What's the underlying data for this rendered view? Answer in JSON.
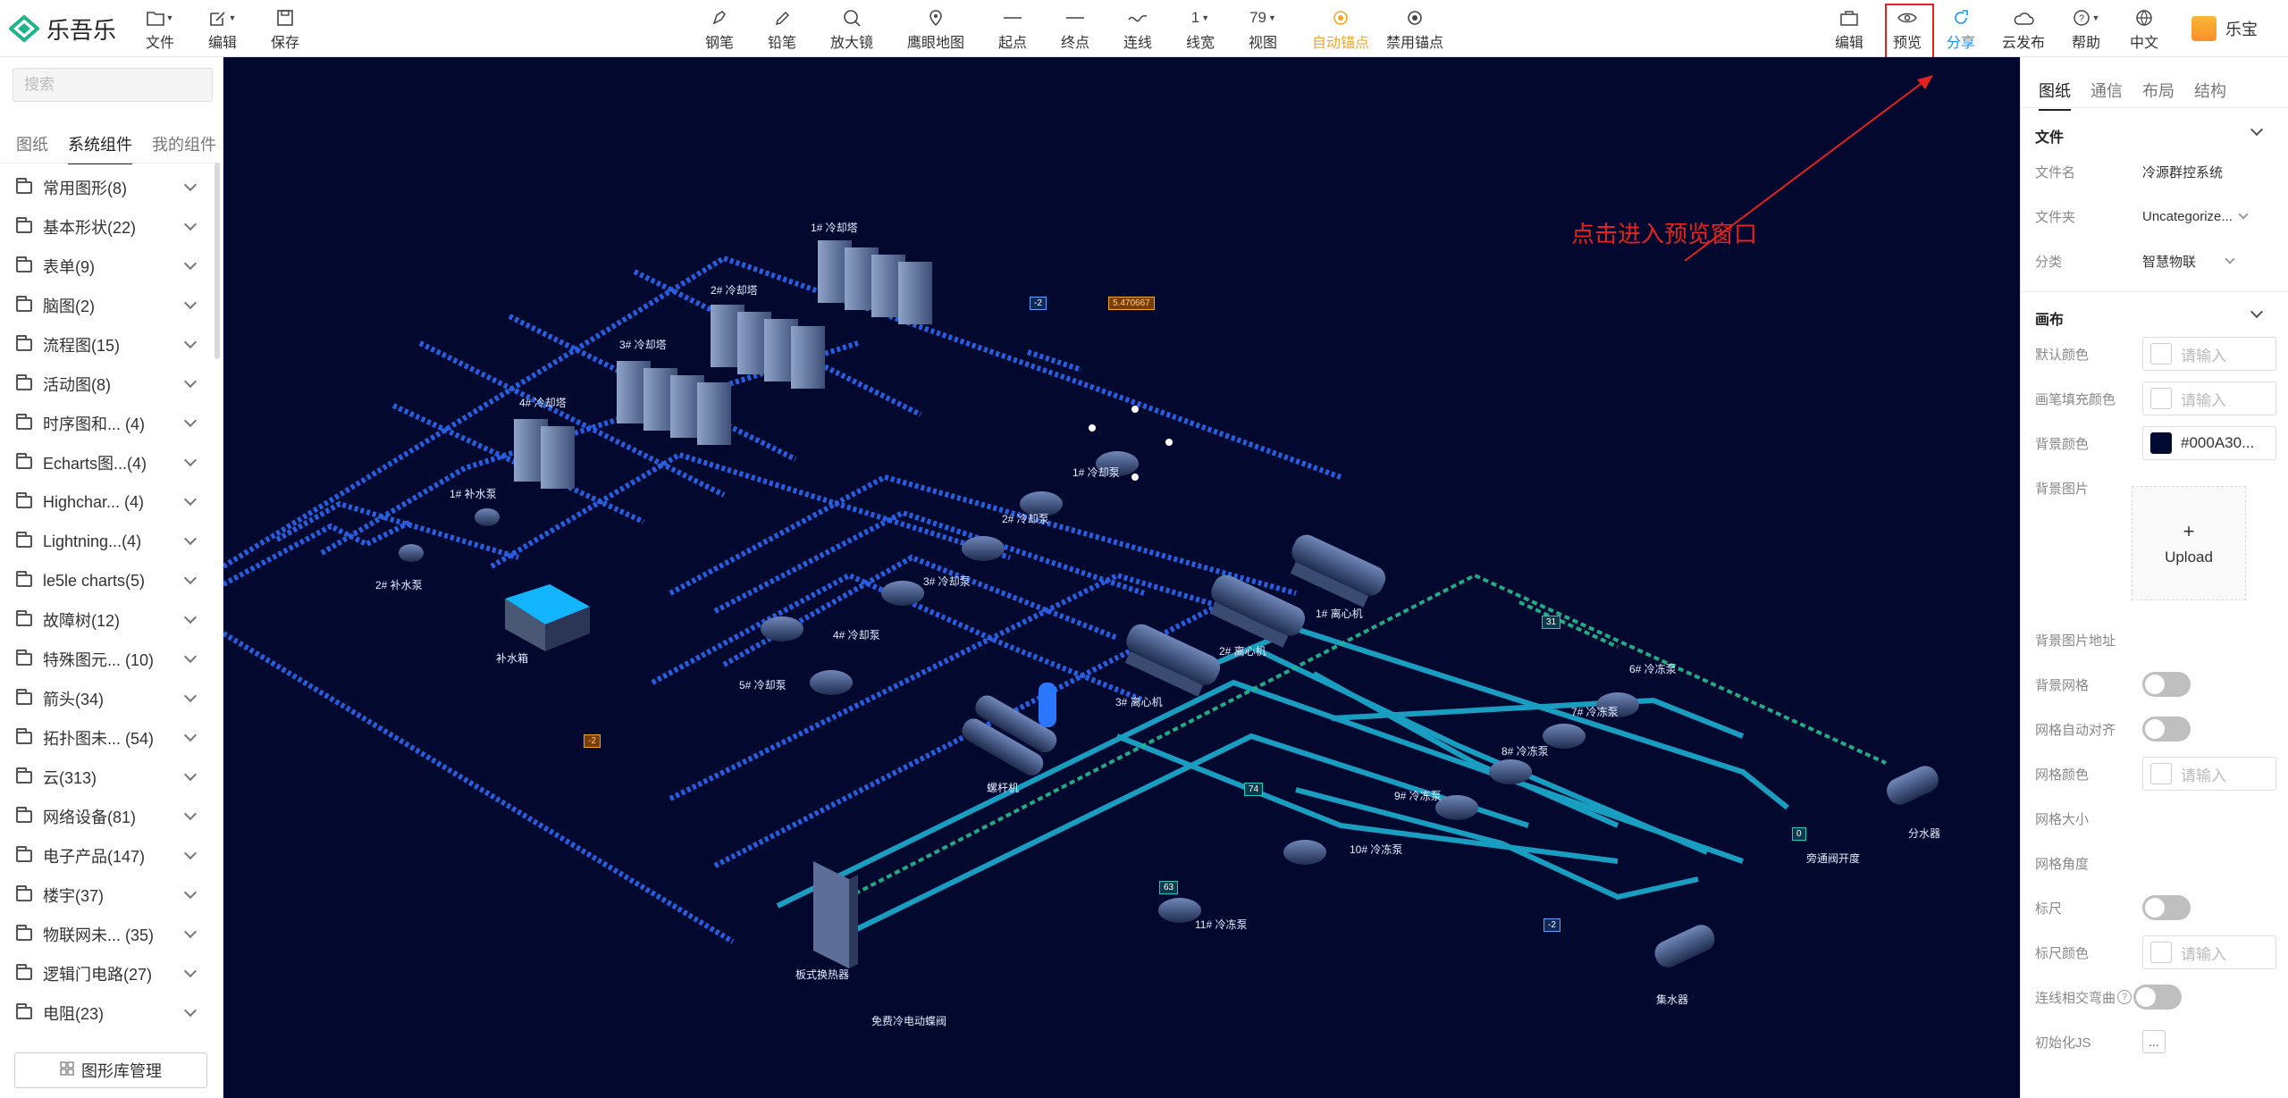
{
  "app": {
    "name": "乐吾乐"
  },
  "toolbar": {
    "left": [
      {
        "label": "文件",
        "icon": "folder-icon",
        "caret": true
      },
      {
        "label": "编辑",
        "icon": "edit-icon",
        "caret": true
      },
      {
        "label": "保存",
        "icon": "save-icon",
        "caret": false
      }
    ],
    "center": [
      {
        "label": "钢笔",
        "icon": "pen-icon"
      },
      {
        "label": "铅笔",
        "icon": "pencil-icon"
      },
      {
        "label": "放大镜",
        "icon": "magnifier-icon"
      },
      {
        "label": "鹰眼地图",
        "icon": "eagle-map-icon"
      },
      {
        "label": "起点",
        "icon": "start-icon"
      },
      {
        "label": "终点",
        "icon": "end-icon"
      },
      {
        "label": "连线",
        "icon": "connector-icon"
      },
      {
        "label": "线宽",
        "icon": "line-width-icon",
        "value": "1"
      },
      {
        "label": "视图",
        "icon": "view-icon",
        "value": "79"
      },
      {
        "label": "自动锚点",
        "icon": "auto-anchor-icon",
        "active": true
      },
      {
        "label": "禁用锚点",
        "icon": "disable-anchor-icon"
      }
    ],
    "right": [
      {
        "label": "编辑",
        "icon": "edit-mode-icon"
      },
      {
        "label": "预览",
        "icon": "eye-icon"
      },
      {
        "label": "分享",
        "icon": "share-icon",
        "highlight": true
      },
      {
        "label": "云发布",
        "icon": "cloud-icon"
      },
      {
        "label": "帮助",
        "icon": "help-icon",
        "caret": true
      },
      {
        "label": "中文",
        "icon": "globe-icon"
      }
    ],
    "user": "乐宝"
  },
  "left_panel": {
    "search_placeholder": "搜索",
    "tabs": [
      "图纸",
      "系统组件",
      "我的组件"
    ],
    "active_tab": "系统组件",
    "categories": [
      "常用图形(8)",
      "基本形状(22)",
      "表单(9)",
      "脑图(2)",
      "流程图(15)",
      "活动图(8)",
      "时序图和... (4)",
      "Echarts图...(4)",
      "Highchar... (4)",
      "Lightning...(4)",
      "le5le charts(5)",
      "故障树(12)",
      "特殊图元... (10)",
      "箭头(34)",
      "拓扑图未... (54)",
      "云(313)",
      "网络设备(81)",
      "电子产品(147)",
      "楼宇(37)",
      "物联网未... (35)",
      "逻辑门电路(27)",
      "电阻(23)"
    ],
    "library_button": "图形库管理"
  },
  "canvas": {
    "annotation": "点击进入预览窗口",
    "labels": {
      "tower1": "1# 冷却塔",
      "tower2": "2# 冷却塔",
      "tower3": "3# 冷却塔",
      "tower4": "4# 冷却塔",
      "makeup1": "1# 补水泵",
      "makeup2": "2# 补水泵",
      "tank": "补水箱",
      "cpump1": "1# 冷却泵",
      "cpump2": "2# 冷却泵",
      "cpump3": "3# 冷却泵",
      "cpump4": "4# 冷却泵",
      "cpump5": "5# 冷却泵",
      "chiller1": "1# 离心机",
      "chiller2": "2# 离心机",
      "chiller3": "3# 离心机",
      "screw": "螺杆机",
      "fpump6": "6# 冷冻泵",
      "fpump7": "7# 冷冻泵",
      "fpump8": "8# 冷冻泵",
      "fpump9": "9# 冷冻泵",
      "fpump10": "10# 冷冻泵",
      "fpump11": "11# 冷冻泵",
      "plate": "板式换热器",
      "valve": "免费冷电动蝶阀",
      "bypass": "旁通阀开度",
      "distributor": "分水器",
      "collector": "集水器"
    },
    "tags": [
      "-2",
      "5.470667",
      "31",
      "74",
      "63",
      "0",
      "-2",
      "-2"
    ]
  },
  "right_panel": {
    "tabs": [
      "图纸",
      "通信",
      "布局",
      "结构"
    ],
    "active_tab": "图纸",
    "file_section": "文件",
    "file_name_label": "文件名",
    "file_name": "冷源群控系统",
    "folder_label": "文件夹",
    "folder": "Uncategorize...",
    "category_label": "分类",
    "category": "智慧物联",
    "canvas_section": "画布",
    "default_color_label": "默认颜色",
    "default_color_ph": "请输入",
    "brush_fill_label": "画笔填充颜色",
    "brush_fill_ph": "请输入",
    "bg_color_label": "背景颜色",
    "bg_color": "#000A30...",
    "bg_image_label": "背景图片",
    "upload": "Upload",
    "bg_image_url_label": "背景图片地址",
    "bg_grid_label": "背景网格",
    "grid_align_label": "网格自动对齐",
    "grid_color_label": "网格颜色",
    "grid_color_ph": "请输入",
    "grid_size_label": "网格大小",
    "grid_angle_label": "网格角度",
    "ruler_label": "标尺",
    "ruler_color_label": "标尺颜色",
    "ruler_color_ph": "请输入",
    "line_cross_label": "连线相交弯曲",
    "init_js_label": "初始化JS",
    "init_js": "..."
  },
  "colors": {
    "accent": "#1890ff",
    "active": "#f5a623",
    "annotation": "#e3231f",
    "canvas_bg": "#03092e"
  }
}
